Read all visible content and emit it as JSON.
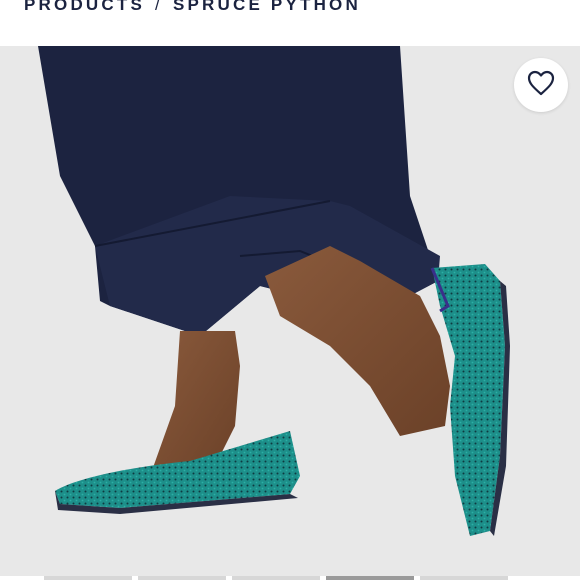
{
  "breadcrumb": {
    "section": "PRODUCTS",
    "separator": "/",
    "current": "SPRUCE PYTHON"
  },
  "product_image": {
    "alt": "Spruce Python flats"
  },
  "favorite": {
    "icon": "heart-outline-icon"
  },
  "colors": {
    "brand_text": "#1b2340",
    "shoe_teal": "#1d8f8a",
    "pants_navy": "#1c2340",
    "background": "#e8e8e8"
  }
}
